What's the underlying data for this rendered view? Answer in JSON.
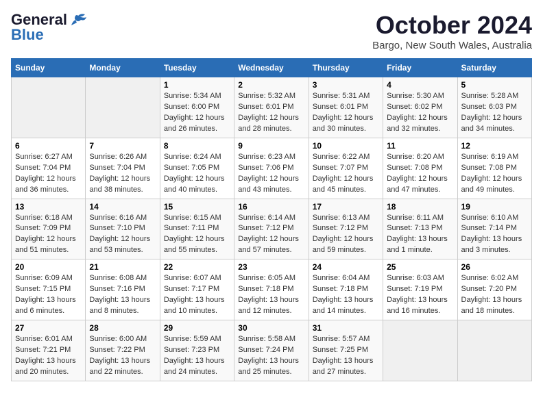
{
  "logo": {
    "general": "General",
    "blue": "Blue"
  },
  "title": "October 2024",
  "subtitle": "Bargo, New South Wales, Australia",
  "days_of_week": [
    "Sunday",
    "Monday",
    "Tuesday",
    "Wednesday",
    "Thursday",
    "Friday",
    "Saturday"
  ],
  "weeks": [
    [
      {
        "day": "",
        "info": ""
      },
      {
        "day": "",
        "info": ""
      },
      {
        "day": "1",
        "info": "Sunrise: 5:34 AM\nSunset: 6:00 PM\nDaylight: 12 hours\nand 26 minutes."
      },
      {
        "day": "2",
        "info": "Sunrise: 5:32 AM\nSunset: 6:01 PM\nDaylight: 12 hours\nand 28 minutes."
      },
      {
        "day": "3",
        "info": "Sunrise: 5:31 AM\nSunset: 6:01 PM\nDaylight: 12 hours\nand 30 minutes."
      },
      {
        "day": "4",
        "info": "Sunrise: 5:30 AM\nSunset: 6:02 PM\nDaylight: 12 hours\nand 32 minutes."
      },
      {
        "day": "5",
        "info": "Sunrise: 5:28 AM\nSunset: 6:03 PM\nDaylight: 12 hours\nand 34 minutes."
      }
    ],
    [
      {
        "day": "6",
        "info": "Sunrise: 6:27 AM\nSunset: 7:04 PM\nDaylight: 12 hours\nand 36 minutes."
      },
      {
        "day": "7",
        "info": "Sunrise: 6:26 AM\nSunset: 7:04 PM\nDaylight: 12 hours\nand 38 minutes."
      },
      {
        "day": "8",
        "info": "Sunrise: 6:24 AM\nSunset: 7:05 PM\nDaylight: 12 hours\nand 40 minutes."
      },
      {
        "day": "9",
        "info": "Sunrise: 6:23 AM\nSunset: 7:06 PM\nDaylight: 12 hours\nand 43 minutes."
      },
      {
        "day": "10",
        "info": "Sunrise: 6:22 AM\nSunset: 7:07 PM\nDaylight: 12 hours\nand 45 minutes."
      },
      {
        "day": "11",
        "info": "Sunrise: 6:20 AM\nSunset: 7:08 PM\nDaylight: 12 hours\nand 47 minutes."
      },
      {
        "day": "12",
        "info": "Sunrise: 6:19 AM\nSunset: 7:08 PM\nDaylight: 12 hours\nand 49 minutes."
      }
    ],
    [
      {
        "day": "13",
        "info": "Sunrise: 6:18 AM\nSunset: 7:09 PM\nDaylight: 12 hours\nand 51 minutes."
      },
      {
        "day": "14",
        "info": "Sunrise: 6:16 AM\nSunset: 7:10 PM\nDaylight: 12 hours\nand 53 minutes."
      },
      {
        "day": "15",
        "info": "Sunrise: 6:15 AM\nSunset: 7:11 PM\nDaylight: 12 hours\nand 55 minutes."
      },
      {
        "day": "16",
        "info": "Sunrise: 6:14 AM\nSunset: 7:12 PM\nDaylight: 12 hours\nand 57 minutes."
      },
      {
        "day": "17",
        "info": "Sunrise: 6:13 AM\nSunset: 7:12 PM\nDaylight: 12 hours\nand 59 minutes."
      },
      {
        "day": "18",
        "info": "Sunrise: 6:11 AM\nSunset: 7:13 PM\nDaylight: 13 hours\nand 1 minute."
      },
      {
        "day": "19",
        "info": "Sunrise: 6:10 AM\nSunset: 7:14 PM\nDaylight: 13 hours\nand 3 minutes."
      }
    ],
    [
      {
        "day": "20",
        "info": "Sunrise: 6:09 AM\nSunset: 7:15 PM\nDaylight: 13 hours\nand 6 minutes."
      },
      {
        "day": "21",
        "info": "Sunrise: 6:08 AM\nSunset: 7:16 PM\nDaylight: 13 hours\nand 8 minutes."
      },
      {
        "day": "22",
        "info": "Sunrise: 6:07 AM\nSunset: 7:17 PM\nDaylight: 13 hours\nand 10 minutes."
      },
      {
        "day": "23",
        "info": "Sunrise: 6:05 AM\nSunset: 7:18 PM\nDaylight: 13 hours\nand 12 minutes."
      },
      {
        "day": "24",
        "info": "Sunrise: 6:04 AM\nSunset: 7:18 PM\nDaylight: 13 hours\nand 14 minutes."
      },
      {
        "day": "25",
        "info": "Sunrise: 6:03 AM\nSunset: 7:19 PM\nDaylight: 13 hours\nand 16 minutes."
      },
      {
        "day": "26",
        "info": "Sunrise: 6:02 AM\nSunset: 7:20 PM\nDaylight: 13 hours\nand 18 minutes."
      }
    ],
    [
      {
        "day": "27",
        "info": "Sunrise: 6:01 AM\nSunset: 7:21 PM\nDaylight: 13 hours\nand 20 minutes."
      },
      {
        "day": "28",
        "info": "Sunrise: 6:00 AM\nSunset: 7:22 PM\nDaylight: 13 hours\nand 22 minutes."
      },
      {
        "day": "29",
        "info": "Sunrise: 5:59 AM\nSunset: 7:23 PM\nDaylight: 13 hours\nand 24 minutes."
      },
      {
        "day": "30",
        "info": "Sunrise: 5:58 AM\nSunset: 7:24 PM\nDaylight: 13 hours\nand 25 minutes."
      },
      {
        "day": "31",
        "info": "Sunrise: 5:57 AM\nSunset: 7:25 PM\nDaylight: 13 hours\nand 27 minutes."
      },
      {
        "day": "",
        "info": ""
      },
      {
        "day": "",
        "info": ""
      }
    ]
  ]
}
